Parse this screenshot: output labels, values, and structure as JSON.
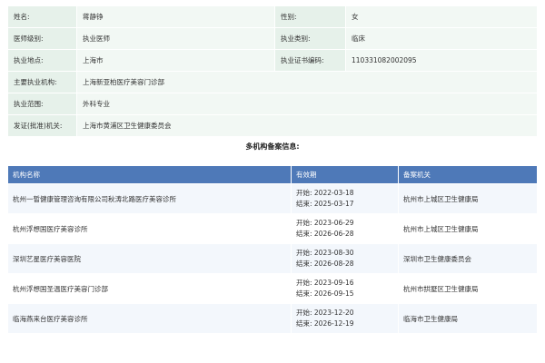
{
  "basic_info": {
    "rows": [
      [
        {
          "label": "姓名:",
          "value": "蒋静铮"
        },
        {
          "label": "性别:",
          "value": "女"
        }
      ],
      [
        {
          "label": "医师级别:",
          "value": "执业医师"
        },
        {
          "label": "执业类别:",
          "value": "临床"
        }
      ],
      [
        {
          "label": "执业地点:",
          "value": "上海市"
        },
        {
          "label": "执业证书编码:",
          "value": "110331082002095"
        }
      ],
      [
        {
          "label": "主要执业机构:",
          "value": "上海新亚柏医疗美容门诊部"
        }
      ],
      [
        {
          "label": "执业范围:",
          "value": "外科专业"
        }
      ],
      [
        {
          "label": "发证(批准)机关:",
          "value": "上海市黄浦区卫生健康委员会"
        }
      ]
    ]
  },
  "multi_section": {
    "title": "多机构备案信息:",
    "headers": [
      "机构名称",
      "有效期",
      "备案机关"
    ],
    "rows": [
      {
        "name": "杭州一皙健康管理咨询有限公司秋涛北路医疗美容诊所",
        "start": "开始:  2022-03-18",
        "end": "结束:  2025-03-17",
        "authority": "杭州市上城区卫生健康局"
      },
      {
        "name": "杭州浮想国医疗美容诊所",
        "start": "开始:  2023-06-29",
        "end": "结束:  2026-06-28",
        "authority": "杭州市上城区卫生健康局"
      },
      {
        "name": "深圳艺星医疗美容医院",
        "start": "开始:  2023-08-30",
        "end": "结束:  2026-08-28",
        "authority": "深圳市卫生健康委员会"
      },
      {
        "name": "杭州浮想国圣温医疗美容门诊部",
        "start": "开始:  2023-09-16",
        "end": "结束:  2026-09-15",
        "authority": "杭州市拱墅区卫生健康局"
      },
      {
        "name": "临海燕来台医疗美容诊所",
        "start": "开始:  2023-12-20",
        "end": "结束:  2026-12-19",
        "authority": "临海市卫生健康局"
      }
    ]
  }
}
